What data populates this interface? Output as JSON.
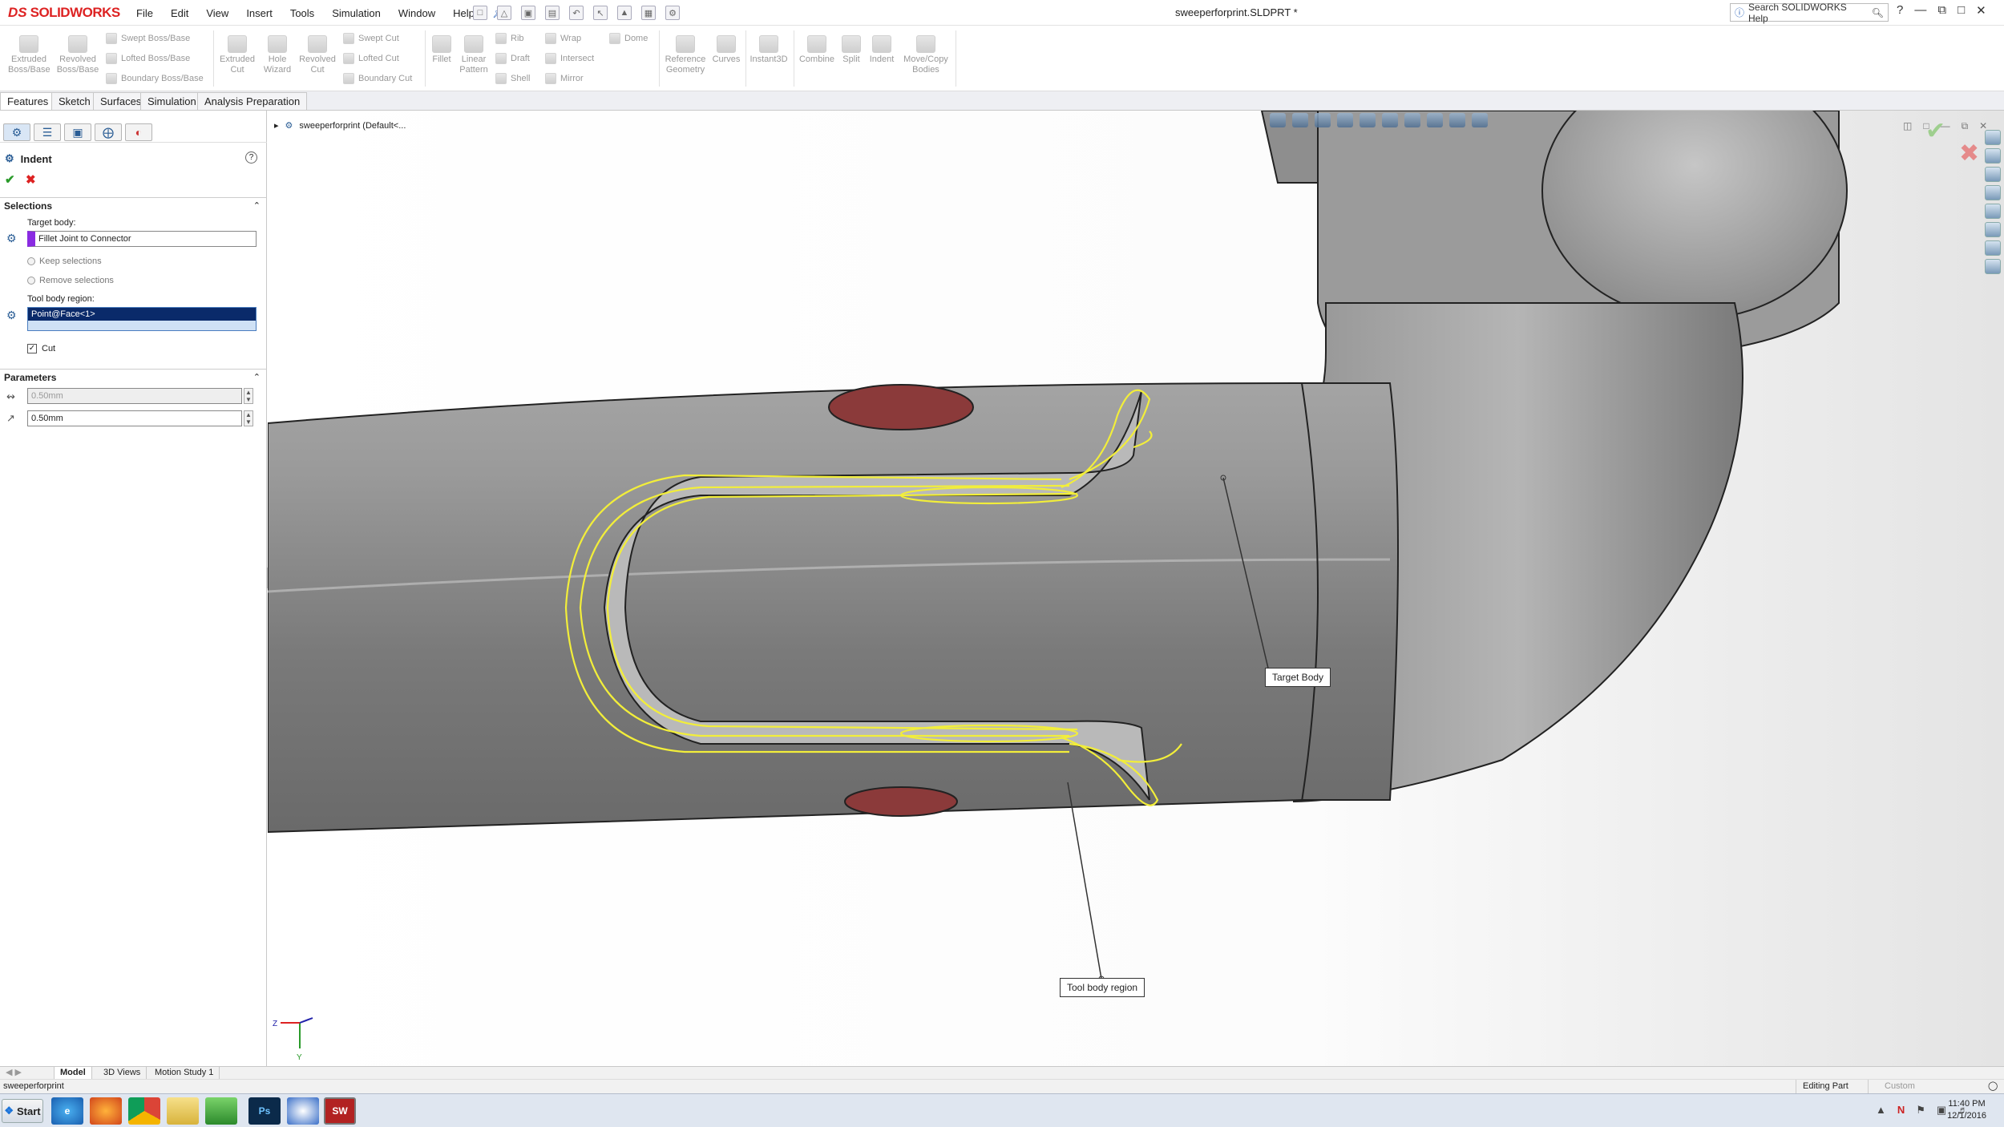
{
  "app": {
    "brand_ds": "DS",
    "brand_name": "SOLIDWORKS",
    "doc_title": "sweeperforprint.SLDPRT *"
  },
  "menu": [
    "File",
    "Edit",
    "View",
    "Insert",
    "Tools",
    "Simulation",
    "Window",
    "Help"
  ],
  "help_search": {
    "placeholder": "Search SOLIDWORKS Help"
  },
  "ribbon": {
    "extruded_boss": "Extruded\nBoss/Base",
    "revolved_boss": "Revolved\nBoss/Base",
    "swept_boss": "Swept Boss/Base",
    "lofted_boss": "Lofted Boss/Base",
    "boundary_boss": "Boundary Boss/Base",
    "extruded_cut": "Extruded\nCut",
    "hole_wizard": "Hole\nWizard",
    "revolved_cut": "Revolved\nCut",
    "swept_cut": "Swept Cut",
    "lofted_cut": "Lofted Cut",
    "boundary_cut": "Boundary Cut",
    "fillet": "Fillet",
    "linear_pattern": "Linear\nPattern",
    "rib": "Rib",
    "draft": "Draft",
    "shell": "Shell",
    "wrap": "Wrap",
    "intersect": "Intersect",
    "mirror": "Mirror",
    "dome": "Dome",
    "reference_geometry": "Reference\nGeometry",
    "curves": "Curves",
    "instant3d": "Instant3D",
    "combine": "Combine",
    "split": "Split",
    "indent": "Indent",
    "move_copy": "Move/Copy\nBodies"
  },
  "cmd_tabs": [
    "Features",
    "Sketch",
    "Surfaces",
    "Simulation",
    "Analysis Preparation"
  ],
  "tree": {
    "root": "sweeperforprint  (Default<..."
  },
  "pm": {
    "title": "Indent",
    "selections": "Selections",
    "target_body_label": "Target body:",
    "target_body_value": "Fillet Joint to Connector",
    "keep_selections": "Keep selections",
    "remove_selections": "Remove selections",
    "tool_body_label": "Tool body region:",
    "tool_body_value": "Point@Face<1>",
    "cut_label": "Cut",
    "parameters": "Parameters",
    "thickness": "0.50mm",
    "clearance": "0.50mm"
  },
  "callouts": {
    "target": "Target Body",
    "tool": "Tool body region"
  },
  "triad": {
    "z": "Z",
    "y": "Y"
  },
  "bottom_tabs": [
    "Model",
    "3D Views",
    "Motion Study 1"
  ],
  "status": {
    "left": "sweeperforprint",
    "mode": "Editing Part",
    "units": "Custom"
  },
  "clock": {
    "time": "11:40 PM",
    "date": "12/1/2016"
  },
  "taskbar": {
    "start": "Start",
    "ps": "Ps",
    "sw": "SW"
  }
}
